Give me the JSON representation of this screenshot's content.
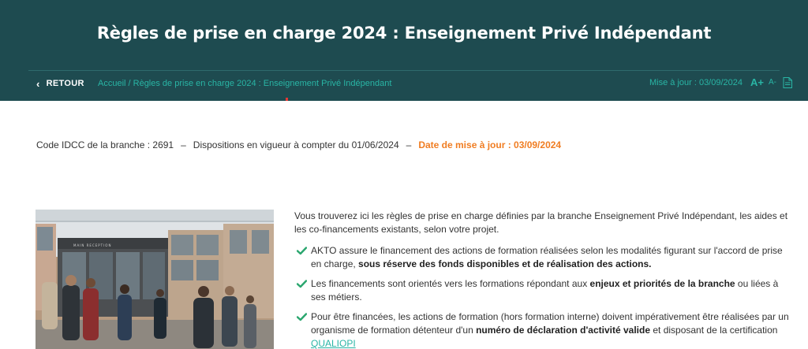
{
  "header": {
    "title": "Règles de prise en charge 2024 : Enseignement Privé Indépendant",
    "back_label": "RETOUR",
    "breadcrumb": "Accueil / Règles de prise en charge 2024 : Enseignement Privé Indépendant",
    "updated": "Mise à jour : 03/09/2024",
    "font_up": "A+",
    "font_down": "A-"
  },
  "meta": {
    "idcc": "Code IDCC de la branche : 2691",
    "sep1": "–",
    "dispositions": "Dispositions en vigueur à compter du 01/06/2024",
    "sep2": "–",
    "update_date": "Date de mise à jour : 03/09/2024"
  },
  "content": {
    "intro": "Vous trouverez ici les règles de prise en charge définies par la branche Enseignement Privé Indépendant, les aides et les co-financements existants, selon votre projet.",
    "items": [
      {
        "text_before": "AKTO assure le financement des actions de formation réalisées selon les modalités figurant sur l'accord de prise en charge, ",
        "bold": "sous réserve des fonds disponibles et de réalisation des actions.",
        "text_after": ""
      },
      {
        "text_before": "Les financements sont orientés vers les formations répondant aux ",
        "bold": "enjeux et priorités de la branche",
        "text_after": " ou liées à ses métiers."
      },
      {
        "text_before": "Pour être financées, les actions de formation (hors formation interne) doivent impérativement être réalisées par un organisme de formation détenteur d'un ",
        "bold": "numéro de déclaration d'activité valide",
        "text_after": " et disposant de la certification ",
        "link": "QUALIOPI"
      }
    ]
  },
  "photo_sign": "MAIN RECEPTION",
  "colors": {
    "header_bg": "#1e4b50",
    "accent_teal": "#29b5a5",
    "accent_orange": "#f07d22",
    "check_green": "#2aa66e"
  }
}
